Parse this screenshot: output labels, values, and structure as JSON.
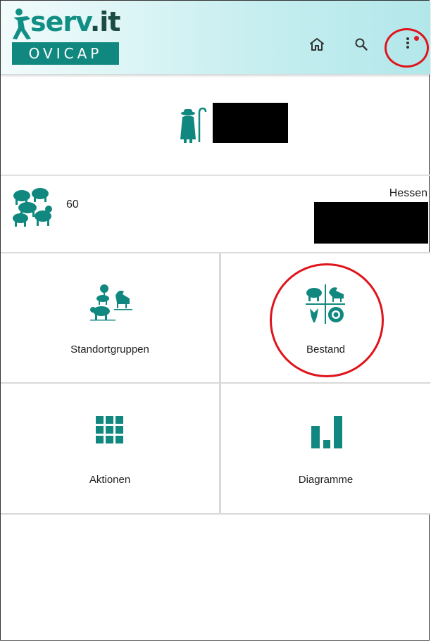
{
  "app": {
    "logo_text_main": "serv",
    "logo_text_dot": ".",
    "logo_text_suffix": "it",
    "logo_subtitle": "OVICAP"
  },
  "header": {
    "icons": [
      "home-icon",
      "search-icon",
      "more-vert-icon"
    ],
    "notification_dot": true
  },
  "farmer": {
    "icon": "shepherd-icon"
  },
  "stats": {
    "icon": "sheep-herd-icon",
    "animal_count": "60",
    "region": "Hessen"
  },
  "tiles": [
    {
      "label": "Standortgruppen",
      "icon": "location-groups-icon"
    },
    {
      "label": "Bestand",
      "icon": "stock-icon"
    },
    {
      "label": "Aktionen",
      "icon": "grid-icon"
    },
    {
      "label": "Diagramme",
      "icon": "bar-chart-icon"
    }
  ],
  "colors": {
    "accent": "#11887f",
    "header_gradient_start": "#f2fbfb",
    "header_gradient_end": "#b2e7ea",
    "highlight_red": "#e0141b",
    "notification_red": "#e01b22"
  }
}
